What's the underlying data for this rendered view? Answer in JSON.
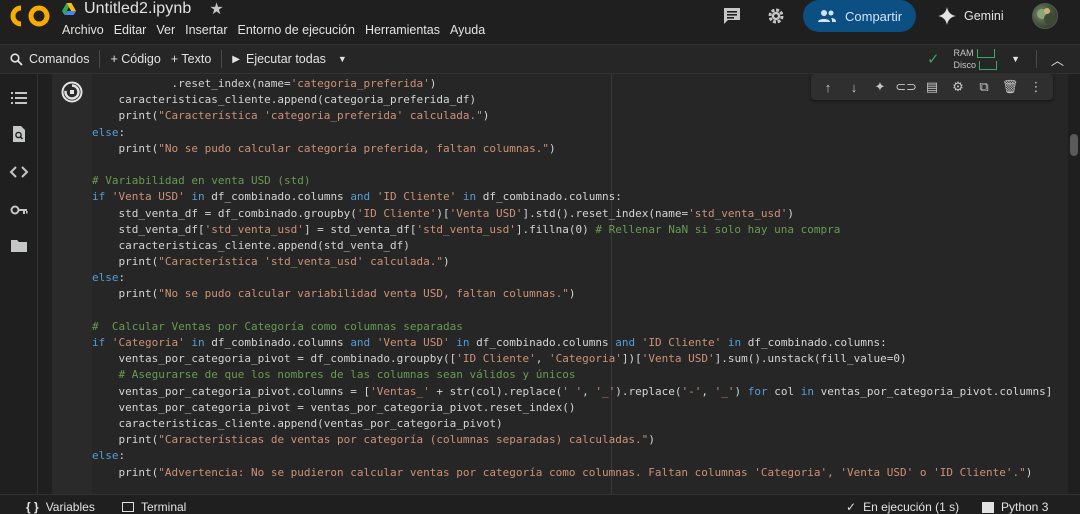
{
  "header": {
    "document_title": "Untitled2.ipynb",
    "menu": [
      "Archivo",
      "Editar",
      "Ver",
      "Insertar",
      "Entorno de ejecución",
      "Herramientas",
      "Ayuda"
    ],
    "share_label": "Compartir",
    "gemini_label": "Gemini"
  },
  "toolbar": {
    "commands_label": "Comandos",
    "add_code_label": "+ Código",
    "add_text_label": "+ Texto",
    "run_all_label": "Ejecutar todas",
    "ram_label": "RAM",
    "disk_label": "Disco"
  },
  "code": {
    "lines": [
      [
        {
          "t": "            .reset_index(name=",
          "c": ""
        },
        {
          "t": "'categoria_preferida'",
          "c": "st"
        },
        {
          "t": ")",
          "c": ""
        }
      ],
      [
        {
          "t": "    caracteristicas_cliente.append(categoria_preferida_df)",
          "c": ""
        }
      ],
      [
        {
          "t": "    print(",
          "c": ""
        },
        {
          "t": "\"Característica 'categoria_preferida' calculada.\"",
          "c": "st"
        },
        {
          "t": ")",
          "c": ""
        }
      ],
      [
        {
          "t": "else",
          "c": "kw"
        },
        {
          "t": ":",
          "c": ""
        }
      ],
      [
        {
          "t": "    print(",
          "c": ""
        },
        {
          "t": "\"No se pudo calcular categoría preferida, faltan columnas.\"",
          "c": "st"
        },
        {
          "t": ")",
          "c": ""
        }
      ],
      [
        {
          "t": "",
          "c": ""
        }
      ],
      [
        {
          "t": "# Variabilidad en venta USD (std)",
          "c": "cm"
        }
      ],
      [
        {
          "t": "if",
          "c": "kw"
        },
        {
          "t": " ",
          "c": ""
        },
        {
          "t": "'Venta USD'",
          "c": "st"
        },
        {
          "t": " ",
          "c": ""
        },
        {
          "t": "in",
          "c": "kw"
        },
        {
          "t": " df_combinado.columns ",
          "c": ""
        },
        {
          "t": "and",
          "c": "kw"
        },
        {
          "t": " ",
          "c": ""
        },
        {
          "t": "'ID Cliente'",
          "c": "st"
        },
        {
          "t": " ",
          "c": ""
        },
        {
          "t": "in",
          "c": "kw"
        },
        {
          "t": " df_combinado.columns:",
          "c": ""
        }
      ],
      [
        {
          "t": "    std_venta_df = df_combinado.groupby(",
          "c": ""
        },
        {
          "t": "'ID Cliente'",
          "c": "st"
        },
        {
          "t": ")[",
          "c": ""
        },
        {
          "t": "'Venta USD'",
          "c": "st"
        },
        {
          "t": "].std().reset_index(name=",
          "c": ""
        },
        {
          "t": "'std_venta_usd'",
          "c": "st"
        },
        {
          "t": ")",
          "c": ""
        }
      ],
      [
        {
          "t": "    std_venta_df[",
          "c": ""
        },
        {
          "t": "'std_venta_usd'",
          "c": "st"
        },
        {
          "t": "] = std_venta_df[",
          "c": ""
        },
        {
          "t": "'std_venta_usd'",
          "c": "st"
        },
        {
          "t": "].fillna(0) ",
          "c": ""
        },
        {
          "t": "# Rellenar NaN si solo hay una compra",
          "c": "cm"
        }
      ],
      [
        {
          "t": "    caracteristicas_cliente.append(std_venta_df)",
          "c": ""
        }
      ],
      [
        {
          "t": "    print(",
          "c": ""
        },
        {
          "t": "\"Característica 'std_venta_usd' calculada.\"",
          "c": "st"
        },
        {
          "t": ")",
          "c": ""
        }
      ],
      [
        {
          "t": "else",
          "c": "kw"
        },
        {
          "t": ":",
          "c": ""
        }
      ],
      [
        {
          "t": "    print(",
          "c": ""
        },
        {
          "t": "\"No se pudo calcular variabilidad venta USD, faltan columnas.\"",
          "c": "st"
        },
        {
          "t": ")",
          "c": ""
        }
      ],
      [
        {
          "t": "",
          "c": ""
        }
      ],
      [
        {
          "t": "#  Calcular Ventas por Categoría como columnas separadas",
          "c": "cm"
        }
      ],
      [
        {
          "t": "if",
          "c": "kw"
        },
        {
          "t": " ",
          "c": ""
        },
        {
          "t": "'Categoria'",
          "c": "st"
        },
        {
          "t": " ",
          "c": ""
        },
        {
          "t": "in",
          "c": "kw"
        },
        {
          "t": " df_combinado.columns ",
          "c": ""
        },
        {
          "t": "and",
          "c": "kw"
        },
        {
          "t": " ",
          "c": ""
        },
        {
          "t": "'Venta USD'",
          "c": "st"
        },
        {
          "t": " ",
          "c": ""
        },
        {
          "t": "in",
          "c": "kw"
        },
        {
          "t": " df_combinado.columns ",
          "c": ""
        },
        {
          "t": "and",
          "c": "kw"
        },
        {
          "t": " ",
          "c": ""
        },
        {
          "t": "'ID Cliente'",
          "c": "st"
        },
        {
          "t": " ",
          "c": ""
        },
        {
          "t": "in",
          "c": "kw"
        },
        {
          "t": " df_combinado.columns:",
          "c": ""
        }
      ],
      [
        {
          "t": "    ventas_por_categoria_pivot = df_combinado.groupby([",
          "c": ""
        },
        {
          "t": "'ID Cliente'",
          "c": "st"
        },
        {
          "t": ", ",
          "c": ""
        },
        {
          "t": "'Categoria'",
          "c": "st"
        },
        {
          "t": "])[",
          "c": ""
        },
        {
          "t": "'Venta USD'",
          "c": "st"
        },
        {
          "t": "].sum().unstack(fill_value=0)",
          "c": ""
        }
      ],
      [
        {
          "t": "    # Asegurarse de que los nombres de las columnas sean válidos y únicos",
          "c": "cm"
        }
      ],
      [
        {
          "t": "    ventas_por_categoria_pivot.columns = [",
          "c": ""
        },
        {
          "t": "'Ventas_'",
          "c": "st"
        },
        {
          "t": " + str(col).replace(",
          "c": ""
        },
        {
          "t": "' '",
          "c": "st"
        },
        {
          "t": ", ",
          "c": ""
        },
        {
          "t": "'_'",
          "c": "st"
        },
        {
          "t": ").replace(",
          "c": ""
        },
        {
          "t": "'-'",
          "c": "st"
        },
        {
          "t": ", ",
          "c": ""
        },
        {
          "t": "'_'",
          "c": "st"
        },
        {
          "t": ") ",
          "c": ""
        },
        {
          "t": "for",
          "c": "kw"
        },
        {
          "t": " col ",
          "c": ""
        },
        {
          "t": "in",
          "c": "kw"
        },
        {
          "t": " ventas_por_categoria_pivot.columns]",
          "c": ""
        }
      ],
      [
        {
          "t": "    ventas_por_categoria_pivot = ventas_por_categoria_pivot.reset_index()",
          "c": ""
        }
      ],
      [
        {
          "t": "    caracteristicas_cliente.append(ventas_por_categoria_pivot)",
          "c": ""
        }
      ],
      [
        {
          "t": "    print(",
          "c": ""
        },
        {
          "t": "\"Características de ventas por categoría (columnas separadas) calculadas.\"",
          "c": "st"
        },
        {
          "t": ")",
          "c": ""
        }
      ],
      [
        {
          "t": "else",
          "c": "kw"
        },
        {
          "t": ":",
          "c": ""
        }
      ],
      [
        {
          "t": "    print(",
          "c": ""
        },
        {
          "t": "\"Advertencia: No se pudieron calcular ventas por categoría como columnas. Faltan columnas 'Categoria', 'Venta USD' o 'ID Cliente'.\"",
          "c": "st"
        },
        {
          "t": ")",
          "c": ""
        }
      ]
    ]
  },
  "statusbar": {
    "variables_label": "Variables",
    "terminal_label": "Terminal",
    "running_label": "En ejecución (1 s)",
    "runtime_label": "Python 3"
  },
  "colors": {
    "accent": "#0b4f83",
    "keyword": "#569cd6",
    "string": "#ce9178",
    "comment": "#6a9955"
  }
}
